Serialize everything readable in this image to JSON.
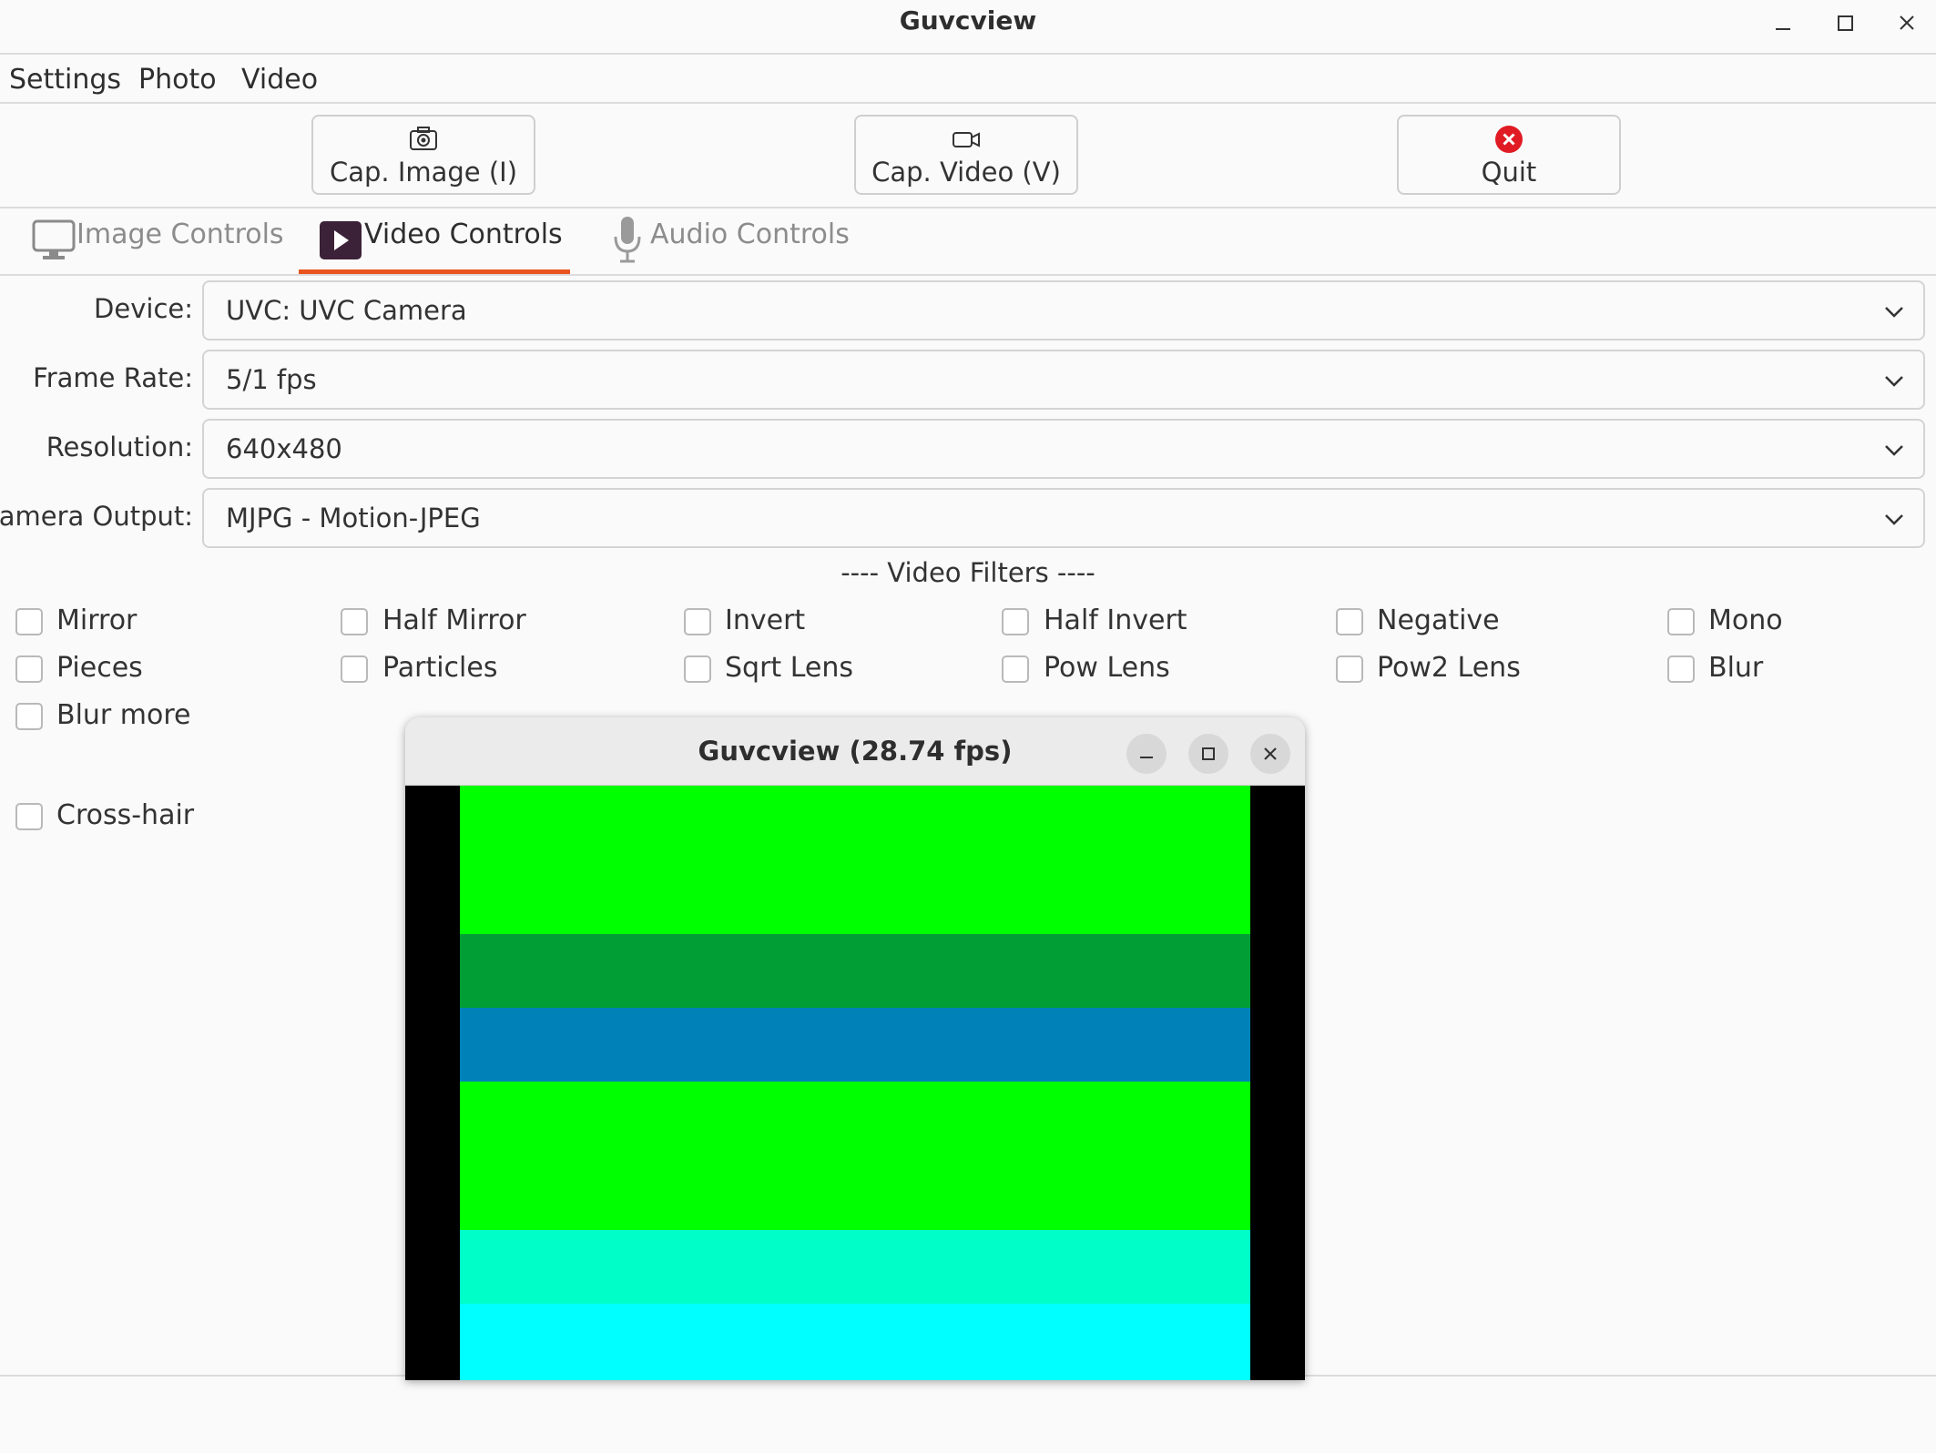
{
  "window": {
    "title": "Guvcview",
    "controls": [
      "minimize-icon",
      "maximize-icon",
      "close-icon"
    ]
  },
  "menu": {
    "items": [
      "Settings",
      "Photo",
      "Video"
    ]
  },
  "toolbar": {
    "cap_image": {
      "label": "Cap. Image (I)",
      "icon": "camera-icon"
    },
    "cap_video": {
      "label": "Cap. Video (V)",
      "icon": "video-camera-icon"
    },
    "quit": {
      "label": "Quit",
      "icon": "quit-icon"
    }
  },
  "tabs": {
    "items": [
      {
        "label": "Image Controls",
        "icon": "monitor-icon",
        "active": false
      },
      {
        "label": "Video Controls",
        "icon": "play-icon",
        "active": true
      },
      {
        "label": "Audio Controls",
        "icon": "microphone-icon",
        "active": false
      }
    ]
  },
  "form": {
    "device": {
      "label": "Device:",
      "value": "UVC: UVC Camera"
    },
    "frame_rate": {
      "label": "Frame Rate:",
      "value": "5/1 fps"
    },
    "resolution": {
      "label": "Resolution:",
      "value": "640x480"
    },
    "camera_output": {
      "label": "Camera Output:",
      "value": "MJPG - Motion-JPEG"
    }
  },
  "filters": {
    "title": "---- Video Filters ----",
    "items": [
      {
        "label": "Mirror",
        "checked": false
      },
      {
        "label": "Half Mirror",
        "checked": false
      },
      {
        "label": "Invert",
        "checked": false
      },
      {
        "label": "Half Invert",
        "checked": false
      },
      {
        "label": "Negative",
        "checked": false
      },
      {
        "label": "Mono",
        "checked": false
      },
      {
        "label": "Pieces",
        "checked": false
      },
      {
        "label": "Particles",
        "checked": false
      },
      {
        "label": "Sqrt Lens",
        "checked": false
      },
      {
        "label": "Pow Lens",
        "checked": false
      },
      {
        "label": "Pow2 Lens",
        "checked": false
      },
      {
        "label": "Blur",
        "checked": false
      },
      {
        "label": "Blur more",
        "checked": false
      }
    ],
    "crosshair": {
      "label": "Cross-hair",
      "checked": false
    }
  },
  "preview": {
    "title": "Guvcview  (28.74 fps)",
    "stripe_colors": [
      "#00ff00",
      "#009e35",
      "#0082b8",
      "#00ff00",
      "#00ffc8",
      "#00ffff"
    ]
  },
  "colors": {
    "accent": "#e95420",
    "quit_red": "#e01b24"
  }
}
